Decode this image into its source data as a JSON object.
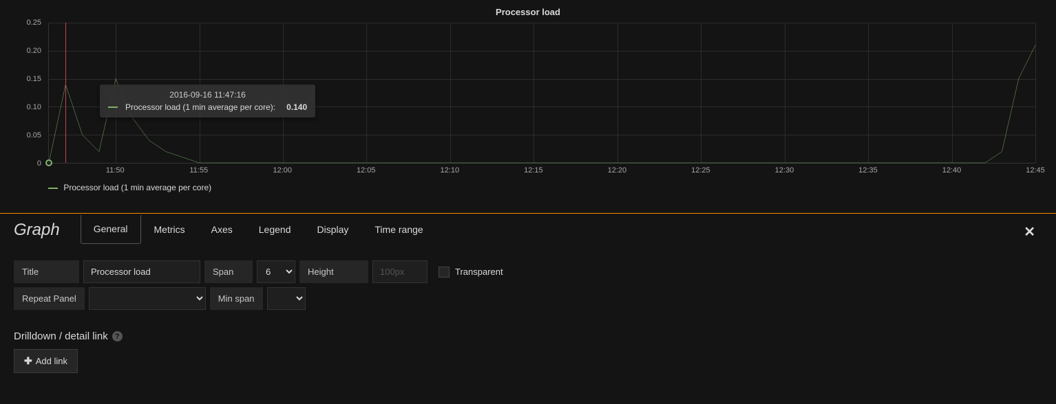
{
  "chart": {
    "title": "Processor load",
    "legend": "Processor load (1 min average per core)"
  },
  "tooltip": {
    "time": "2016-09-16 11:47:16",
    "series_label": "Processor load (1 min average per core):",
    "value": "0.140"
  },
  "editor": {
    "title": "Graph",
    "tabs": [
      "General",
      "Metrics",
      "Axes",
      "Legend",
      "Display",
      "Time range"
    ],
    "active_tab": "General",
    "labels": {
      "title": "Title",
      "span": "Span",
      "height": "Height",
      "transparent": "Transparent",
      "repeat": "Repeat Panel",
      "min_span": "Min span"
    },
    "fields": {
      "title_value": "Processor load",
      "span_value": "6",
      "height_placeholder": "100px"
    },
    "drilldown_title": "Drilldown / detail link",
    "add_link_label": "Add link"
  },
  "chart_data": {
    "type": "line",
    "title": "Processor load",
    "xlabel": "",
    "ylabel": "",
    "ylim": [
      0,
      0.25
    ],
    "x_ticks": [
      "11:50",
      "11:55",
      "12:00",
      "12:05",
      "12:10",
      "12:15",
      "12:20",
      "12:25",
      "12:30",
      "12:35",
      "12:40",
      "12:45"
    ],
    "y_ticks": [
      0,
      0.05,
      0.1,
      0.15,
      0.2,
      0.25
    ],
    "series": [
      {
        "name": "Processor load (1 min average per core)",
        "color": "#7eb26d",
        "x": [
          "11:46",
          "11:47",
          "11:48",
          "11:49",
          "11:50",
          "11:51",
          "11:52",
          "11:53",
          "11:54",
          "11:55",
          "12:00",
          "12:40",
          "12:42",
          "12:43",
          "12:44",
          "12:45"
        ],
        "y": [
          0.0,
          0.14,
          0.05,
          0.02,
          0.15,
          0.08,
          0.04,
          0.02,
          0.01,
          0.0,
          0.0,
          0.0,
          0.0,
          0.02,
          0.15,
          0.21
        ]
      }
    ],
    "crosshair_x": "11:47"
  }
}
